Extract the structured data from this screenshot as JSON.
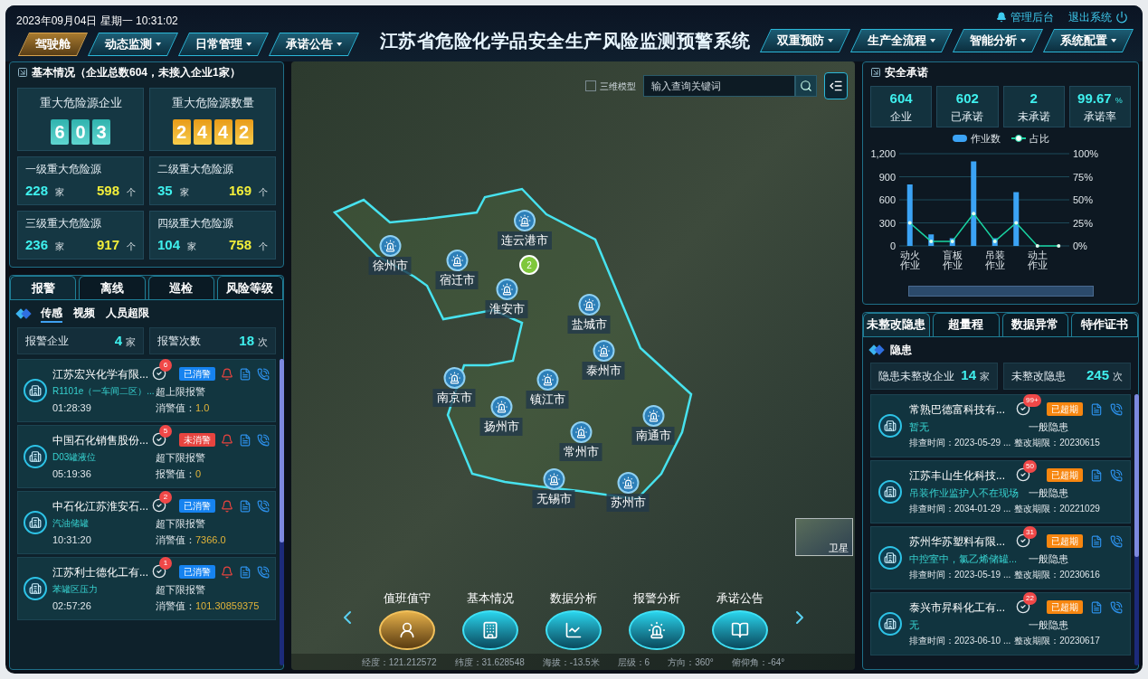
{
  "header": {
    "datetime": "2023年09月04日 星期一 10:31:02",
    "title": "江苏省危险化学品安全生产风险监测预警系统",
    "admin_link": "管理后台",
    "logout_link": "退出系统",
    "left_tabs": [
      {
        "label": "驾驶舱",
        "selected": true,
        "dropdown": false
      },
      {
        "label": "动态监测",
        "selected": false,
        "dropdown": true
      },
      {
        "label": "日常管理",
        "selected": false,
        "dropdown": true
      },
      {
        "label": "承诺公告",
        "selected": false,
        "dropdown": true
      }
    ],
    "right_tabs": [
      {
        "label": "双重预防",
        "selected": false,
        "dropdown": true
      },
      {
        "label": "生产全流程",
        "selected": false,
        "dropdown": true
      },
      {
        "label": "智能分析",
        "selected": false,
        "dropdown": true
      },
      {
        "label": "系统配置",
        "selected": false,
        "dropdown": true
      }
    ]
  },
  "basic_info": {
    "title": "基本情况（企业总数604，未接入企业1家）",
    "counters": [
      {
        "label": "重大危险源企业",
        "digits": [
          "6",
          "0",
          "3"
        ],
        "kind": "teal"
      },
      {
        "label": "重大危险源数量",
        "digits": [
          "2",
          "4",
          "4",
          "2"
        ],
        "kind": "gold"
      }
    ],
    "levels": [
      {
        "label": "一级重大危险源",
        "companies": "228",
        "company_unit": "家",
        "sources": "598",
        "source_unit": "个"
      },
      {
        "label": "二级重大危险源",
        "companies": "35",
        "company_unit": "家",
        "sources": "169",
        "source_unit": "个"
      },
      {
        "label": "三级重大危险源",
        "companies": "236",
        "company_unit": "家",
        "sources": "917",
        "source_unit": "个"
      },
      {
        "label": "四级重大危险源",
        "companies": "104",
        "company_unit": "家",
        "sources": "758",
        "source_unit": "个"
      }
    ]
  },
  "alarm_panel": {
    "tabs": [
      {
        "label": "报警",
        "selected": true
      },
      {
        "label": "离线",
        "selected": false
      },
      {
        "label": "巡检",
        "selected": false
      },
      {
        "label": "风险等级",
        "selected": false
      }
    ],
    "subtabs": [
      {
        "label": "传感",
        "selected": true
      },
      {
        "label": "视频",
        "selected": false
      },
      {
        "label": "人员超限",
        "selected": false
      }
    ],
    "stats": [
      {
        "label": "报警企业",
        "value": "4",
        "unit": "家"
      },
      {
        "label": "报警次数",
        "value": "18",
        "unit": "次"
      }
    ],
    "items": [
      {
        "name": "江苏宏兴化学有限...",
        "count": "6",
        "status": "已消警",
        "cleared": true,
        "location": "R1101e（一车间二区）...",
        "type": "超上限报警",
        "time": "01:28:39",
        "value_label": "消警值：",
        "value": "1.0"
      },
      {
        "name": "中国石化销售股份...",
        "count": "5",
        "status": "未消警",
        "cleared": false,
        "location": "D03罐液位",
        "type": "超下限报警",
        "time": "05:19:36",
        "value_label": "报警值：",
        "value": "0"
      },
      {
        "name": "中石化江苏淮安石...",
        "count": "2",
        "status": "已消警",
        "cleared": true,
        "location": "汽油储罐",
        "type": "超下限报警",
        "time": "10:31:20",
        "value_label": "消警值：",
        "value": "7366.0"
      },
      {
        "name": "江苏利士德化工有...",
        "count": "1",
        "status": "已消警",
        "cleared": true,
        "location": "苯罐区压力",
        "type": "超下限报警",
        "time": "02:57:26",
        "value_label": "消警值：",
        "value": "101.30859375"
      }
    ]
  },
  "map": {
    "model_toggle": {
      "label": "三维模型",
      "checked": false
    },
    "search": {
      "placeholder": "输入查询关键词"
    },
    "cities": [
      {
        "name": "连云港市"
      },
      {
        "name": "徐州市"
      },
      {
        "name": "宿迁市"
      },
      {
        "name": "淮安市"
      },
      {
        "name": "盐城市"
      },
      {
        "name": "泰州市"
      },
      {
        "name": "南京市"
      },
      {
        "name": "扬州市"
      },
      {
        "name": "镇江市"
      },
      {
        "name": "常州市"
      },
      {
        "name": "南通市"
      },
      {
        "name": "无锡市"
      },
      {
        "name": "苏州市"
      }
    ],
    "cluster": "2",
    "satellite_label": "卫星",
    "nav": [
      {
        "label": "值班值守",
        "selected": true
      },
      {
        "label": "基本情况",
        "selected": false
      },
      {
        "label": "数据分析",
        "selected": false
      },
      {
        "label": "报警分析",
        "selected": false
      },
      {
        "label": "承诺公告",
        "selected": false
      }
    ],
    "status_bar": [
      "经度：121.212572",
      "纬度：31.628548",
      "海拔：-13.5米",
      "层级：6",
      "方向：360°",
      "俯仰角：-64°"
    ]
  },
  "commitment": {
    "title": "安全承诺",
    "stats": [
      {
        "value": "604",
        "label": "企业"
      },
      {
        "value": "602",
        "label": "已承诺"
      },
      {
        "value": "2",
        "label": "未承诺"
      },
      {
        "value": "99.67",
        "unit": "%",
        "label": "承诺率"
      }
    ],
    "chart_data": {
      "type": "bar",
      "stacked": false,
      "grid": true,
      "legend": "top",
      "categories": [
        "动火作业",
        null,
        "盲板作业",
        null,
        "吊装作业",
        null,
        "动土作业",
        null
      ],
      "series": [
        {
          "name": "作业数",
          "type": "bar",
          "color": "#3ba3f5",
          "values": [
            800,
            150,
            100,
            1100,
            100,
            700,
            0,
            0
          ]
        },
        {
          "name": "占比",
          "type": "line",
          "axis": "y2",
          "color": "#19d3a2",
          "values": [
            25,
            5,
            5,
            35,
            5,
            25,
            0,
            0
          ]
        }
      ],
      "ylim": [
        0,
        1200
      ],
      "yticks": [
        {
          "value": 0,
          "label": "0"
        },
        {
          "value": 300,
          "label": "300"
        },
        {
          "value": 600,
          "label": "600"
        },
        {
          "value": 900,
          "label": "900"
        },
        {
          "value": 1200,
          "label": "1,200"
        }
      ],
      "y2lim": [
        0,
        100
      ],
      "y2ticks": [
        {
          "value": 0,
          "label": "0%"
        },
        {
          "value": 25,
          "label": "25%"
        },
        {
          "value": 50,
          "label": "50%"
        },
        {
          "value": 75,
          "label": "75%"
        },
        {
          "value": 100,
          "label": "100%"
        }
      ]
    }
  },
  "hazard_panel": {
    "tabs": [
      {
        "label": "未整改隐患",
        "selected": true
      },
      {
        "label": "超量程",
        "selected": false
      },
      {
        "label": "数据异常",
        "selected": false
      },
      {
        "label": "特作证书",
        "selected": false
      }
    ],
    "subtitle": "隐患",
    "stats": [
      {
        "label": "隐患未整改企业",
        "value": "14",
        "unit": "家"
      },
      {
        "label": "未整改隐患",
        "value": "245",
        "unit": "次"
      }
    ],
    "items": [
      {
        "name": "常熟巴德富科技有...",
        "count": "99+",
        "status": "已超期",
        "desc": "暂无",
        "level": "一般隐患",
        "check_time": "排查时间：2023-05-29 ...",
        "deadline": "整改期限：20230615"
      },
      {
        "name": "江苏丰山生化科技...",
        "count": "50",
        "status": "已超期",
        "desc": "吊装作业监护人不在现场",
        "level": "一般隐患",
        "check_time": "排查时间：2034-01-29 ...",
        "deadline": "整改期限：20221029"
      },
      {
        "name": "苏州华苏塑料有限...",
        "count": "31",
        "status": "已超期",
        "desc": "中控室中，氯乙烯储罐...",
        "level": "一般隐患",
        "check_time": "排查时间：2023-05-19 ...",
        "deadline": "整改期限：20230616"
      },
      {
        "name": "泰兴市昇科化工有...",
        "count": "22",
        "status": "已超期",
        "desc": "无",
        "level": "一般隐患",
        "check_time": "排查时间：2023-06-10 ...",
        "deadline": "整改期限：20230617"
      }
    ]
  }
}
